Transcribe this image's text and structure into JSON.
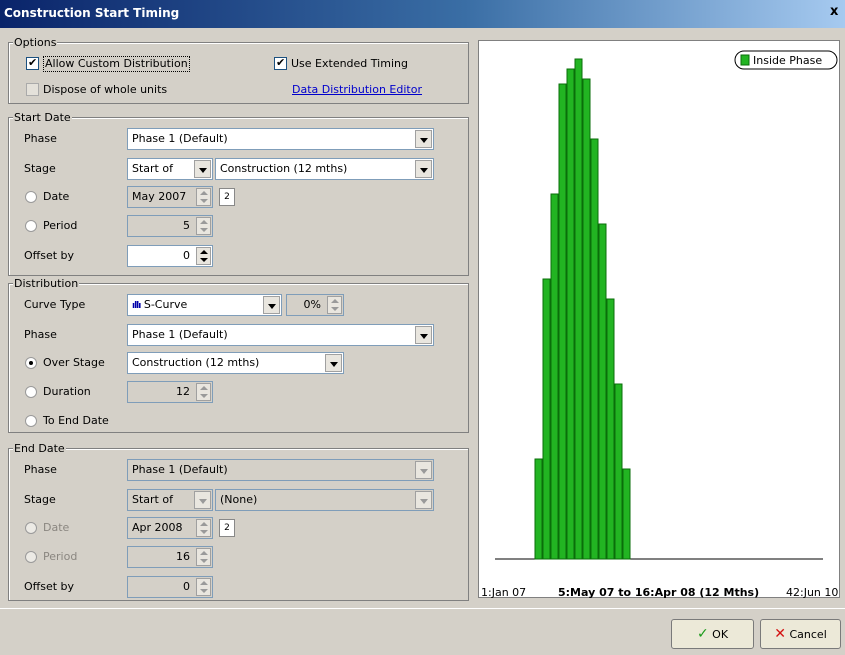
{
  "window": {
    "title": "Construction Start Timing",
    "close_glyph": "x"
  },
  "options": {
    "legend": "Options",
    "allow_custom_distribution": {
      "label": "Allow Custom Distribution",
      "checked": true
    },
    "use_extended_timing": {
      "label": "Use Extended Timing",
      "checked": true
    },
    "dispose_whole_units": {
      "label": "Dispose of whole units",
      "checked": false
    },
    "data_distribution_editor": "Data Distribution Editor"
  },
  "start_date": {
    "legend": "Start Date",
    "phase_label": "Phase",
    "phase_value": "Phase 1  (Default)",
    "stage_label": "Stage",
    "stage_mode": "Start of",
    "stage_value": "Construction (12 mths)",
    "date_label": "Date",
    "date_value": "May 2007",
    "period_label": "Period",
    "period_value": "5",
    "offset_label": "Offset by",
    "offset_value": "0",
    "selected": "none"
  },
  "distribution": {
    "legend": "Distribution",
    "curve_type_label": "Curve Type",
    "curve_type_value": "S-Curve",
    "curve_percent": "0%",
    "phase_label": "Phase",
    "phase_value": "Phase 1  (Default)",
    "over_stage_label": "Over Stage",
    "over_stage_value": "Construction (12 mths)",
    "duration_label": "Duration",
    "duration_value": "12",
    "to_end_date_label": "To End Date",
    "selected": "over_stage"
  },
  "end_date": {
    "legend": "End Date",
    "phase_label": "Phase",
    "phase_value": "Phase 1  (Default)",
    "stage_label": "Stage",
    "stage_mode": "Start of",
    "stage_value": "(None)",
    "date_label": "Date",
    "date_value": "Apr 2008",
    "period_label": "Period",
    "period_value": "16",
    "offset_label": "Offset by",
    "offset_value": "0"
  },
  "chart_data": {
    "type": "bar",
    "legend": "Inside Phase",
    "x_start_label": "1:Jan 07",
    "x_range_label": "5:May 07 to 16:Apr 08 (12 Mths)",
    "x_end_label": "42:Jun 10",
    "categories": [
      "5",
      "6",
      "7",
      "8",
      "9",
      "10",
      "11",
      "12",
      "13",
      "14",
      "15",
      "16"
    ],
    "values": [
      20,
      56,
      73,
      95,
      98,
      100,
      96,
      84,
      67,
      52,
      35,
      18
    ],
    "ylim": [
      0,
      100
    ],
    "color": "#22b422"
  },
  "buttons": {
    "ok": "OK",
    "cancel": "Cancel"
  }
}
